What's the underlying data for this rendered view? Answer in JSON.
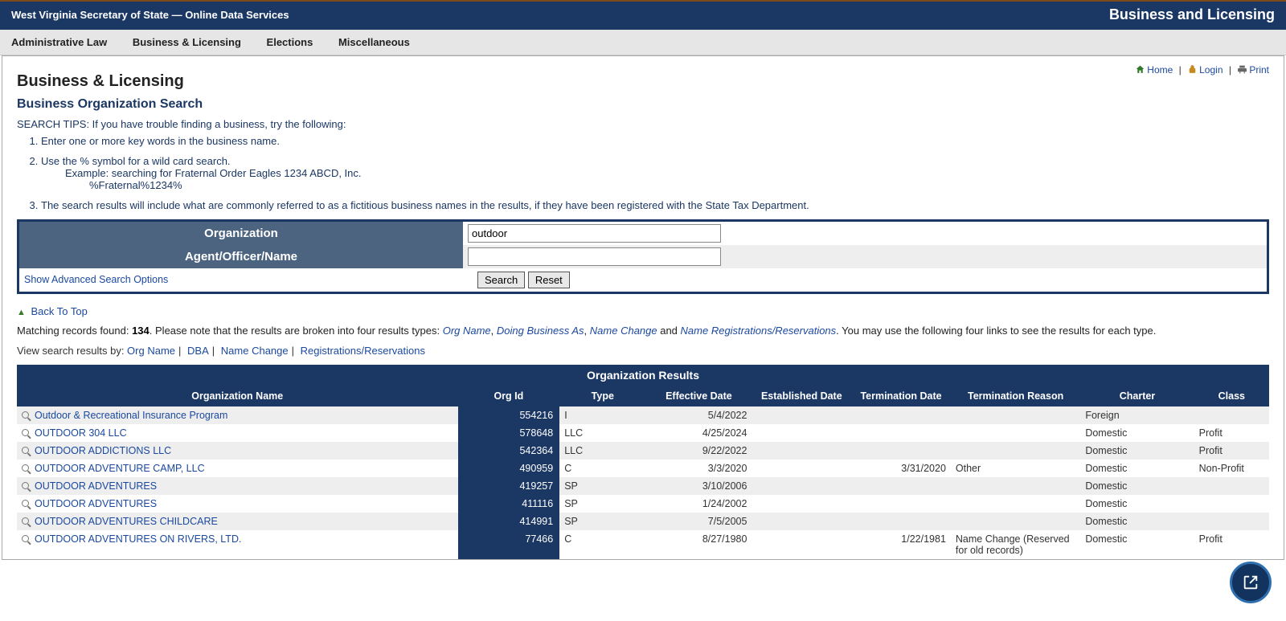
{
  "topbar": {
    "left": "West Virginia Secretary of State — Online Data Services",
    "right": "Business and Licensing"
  },
  "menubar": [
    "Administrative Law",
    "Business & Licensing",
    "Elections",
    "Miscellaneous"
  ],
  "toplinks": {
    "home": "Home",
    "login": "Login",
    "print": "Print"
  },
  "page_title": "Business & Licensing",
  "section_title": "Business Organization Search",
  "tips": {
    "head": "SEARCH TIPS: If you have trouble finding a business, try the following:",
    "items": [
      "Enter one or more key words in the business name.",
      "Use the % symbol for a wild card search.",
      "The search results will include what are commonly referred to as a fictitious business names in the results, if they have been registered with the State Tax Department."
    ],
    "example_lead": "Example: searching for Fraternal Order Eagles 1234 ABCD, Inc.",
    "example_query": "%Fraternal%1234%"
  },
  "search": {
    "label_org": "Organization",
    "label_agent": "Agent/Officer/Name",
    "value_org": "outdoor",
    "value_agent": "",
    "adv_link": "Show Advanced Search Options",
    "button_search": "Search",
    "button_reset": "Reset"
  },
  "back_to_top": "Back To Top",
  "results_intro": {
    "pre": "Matching records found: ",
    "count": "134",
    "mid": ". Please note that the results are broken into four results types: ",
    "types": [
      "Org Name",
      "Doing Business As",
      "Name Change"
    ],
    "and_word": " and ",
    "last_type": "Name Registrations/Reservations",
    "post": ". You may use the following four links to see the results for each type."
  },
  "view_by": {
    "lead": "View search results by: ",
    "links": [
      "Org Name",
      "DBA",
      "Name Change",
      "Registrations/Reservations"
    ]
  },
  "table": {
    "caption": "Organization Results",
    "headers": [
      "Organization Name",
      "Org Id",
      "Type",
      "Effective Date",
      "Established Date",
      "Termination Date",
      "Termination Reason",
      "Charter",
      "Class"
    ],
    "rows": [
      {
        "name": "Outdoor & Recreational Insurance Program",
        "orgid": "554216",
        "type": "I",
        "eff": "5/4/2022",
        "est": "",
        "term": "",
        "reason": "",
        "charter": "Foreign",
        "class": ""
      },
      {
        "name": "OUTDOOR 304 LLC",
        "orgid": "578648",
        "type": "LLC",
        "eff": "4/25/2024",
        "est": "",
        "term": "",
        "reason": "",
        "charter": "Domestic",
        "class": "Profit"
      },
      {
        "name": "OUTDOOR ADDICTIONS LLC",
        "orgid": "542364",
        "type": "LLC",
        "eff": "9/22/2022",
        "est": "",
        "term": "",
        "reason": "",
        "charter": "Domestic",
        "class": "Profit"
      },
      {
        "name": "OUTDOOR ADVENTURE CAMP, LLC",
        "orgid": "490959",
        "type": "C",
        "eff": "3/3/2020",
        "est": "",
        "term": "3/31/2020",
        "reason": "Other",
        "charter": "Domestic",
        "class": "Non-Profit"
      },
      {
        "name": "OUTDOOR ADVENTURES",
        "orgid": "419257",
        "type": "SP",
        "eff": "3/10/2006",
        "est": "",
        "term": "",
        "reason": "",
        "charter": "Domestic",
        "class": ""
      },
      {
        "name": "OUTDOOR ADVENTURES",
        "orgid": "411116",
        "type": "SP",
        "eff": "1/24/2002",
        "est": "",
        "term": "",
        "reason": "",
        "charter": "Domestic",
        "class": ""
      },
      {
        "name": "OUTDOOR ADVENTURES CHILDCARE",
        "orgid": "414991",
        "type": "SP",
        "eff": "7/5/2005",
        "est": "",
        "term": "",
        "reason": "",
        "charter": "Domestic",
        "class": ""
      },
      {
        "name": "OUTDOOR ADVENTURES ON RIVERS, LTD.",
        "orgid": "77466",
        "type": "C",
        "eff": "8/27/1980",
        "est": "",
        "term": "1/22/1981",
        "reason": "Name Change (Reserved for old records)",
        "charter": "Domestic",
        "class": "Profit"
      }
    ]
  }
}
